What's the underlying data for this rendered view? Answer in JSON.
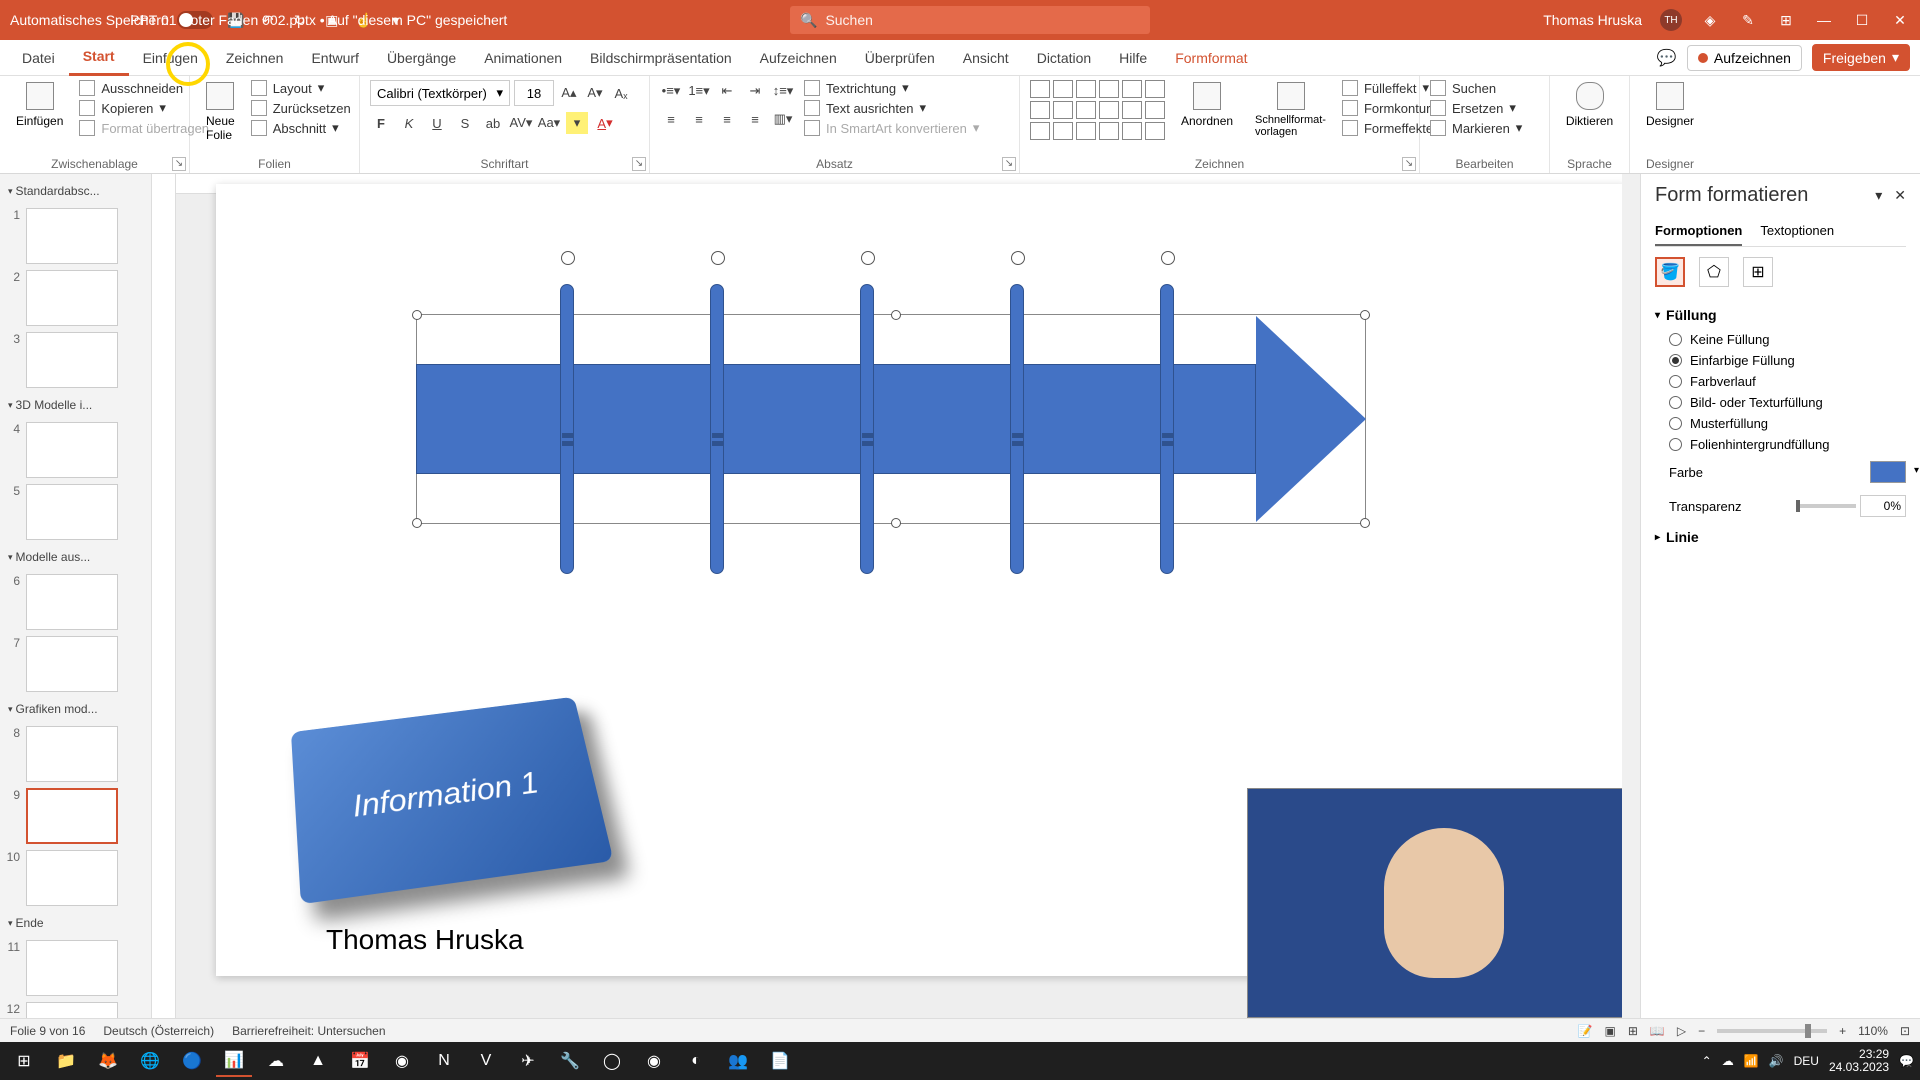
{
  "titlebar": {
    "autosave_label": "Automatisches Speichern",
    "doc_title": "PPT 01 Roter Faden 002.pptx • Auf \"diesem PC\" gespeichert",
    "search_placeholder": "Suchen",
    "user_name": "Thomas Hruska",
    "user_initials": "TH"
  },
  "tabs": {
    "items": [
      "Datei",
      "Start",
      "Einfügen",
      "Zeichnen",
      "Entwurf",
      "Übergänge",
      "Animationen",
      "Bildschirmpräsentation",
      "Aufzeichnen",
      "Überprüfen",
      "Ansicht",
      "Dictation",
      "Hilfe",
      "Formformat"
    ],
    "active": "Start",
    "record": "Aufzeichnen",
    "share": "Freigeben"
  },
  "ribbon": {
    "paste": "Einfügen",
    "cut": "Ausschneiden",
    "copy": "Kopieren",
    "format_painter": "Format übertragen",
    "clipboard_label": "Zwischenablage",
    "new_slide": "Neue Folie",
    "layout": "Layout",
    "reset": "Zurücksetzen",
    "section": "Abschnitt",
    "slides_label": "Folien",
    "font_name": "Calibri (Textkörper)",
    "font_size": "18",
    "font_label": "Schriftart",
    "paragraph_label": "Absatz",
    "text_direction": "Textrichtung",
    "align_text": "Text ausrichten",
    "convert_smartart": "In SmartArt konvertieren",
    "arrange": "Anordnen",
    "quick_styles": "Schnellformat-vorlagen",
    "shape_fill": "Fülleffekt",
    "shape_outline": "Formkontur",
    "shape_effects": "Formeffekte",
    "drawing_label": "Zeichnen",
    "find": "Suchen",
    "replace": "Ersetzen",
    "select": "Markieren",
    "editing_label": "Bearbeiten",
    "dictate": "Diktieren",
    "voice_label": "Sprache",
    "designer": "Designer",
    "designer_label": "Designer"
  },
  "thumbs": {
    "sections": [
      {
        "name": "Standardabsc...",
        "slides": [
          1,
          2,
          3
        ]
      },
      {
        "name": "3D Modelle i...",
        "slides": [
          4,
          5
        ]
      },
      {
        "name": "Modelle aus...",
        "slides": [
          6,
          7
        ]
      },
      {
        "name": "Grafiken mod...",
        "slides": [
          8,
          9,
          10
        ]
      },
      {
        "name": "Ende",
        "slides": [
          11,
          12
        ]
      }
    ],
    "selected": 9
  },
  "slide": {
    "info_text": "Information 1",
    "author": "Thomas Hruska"
  },
  "pane": {
    "title": "Form formatieren",
    "tab_shape": "Formoptionen",
    "tab_text": "Textoptionen",
    "fill_header": "Füllung",
    "no_fill": "Keine Füllung",
    "solid_fill": "Einfarbige Füllung",
    "gradient_fill": "Farbverlauf",
    "picture_fill": "Bild- oder Texturfüllung",
    "pattern_fill": "Musterfüllung",
    "slide_bg_fill": "Folienhintergrundfüllung",
    "color_label": "Farbe",
    "transparency_label": "Transparenz",
    "transparency_value": "0%",
    "line_header": "Linie"
  },
  "statusbar": {
    "slide_info": "Folie 9 von 16",
    "language": "Deutsch (Österreich)",
    "accessibility": "Barrierefreiheit: Untersuchen",
    "zoom": "110%"
  },
  "taskbar": {
    "lang": "DEU",
    "time": "23:29",
    "date": "24.03.2023"
  }
}
